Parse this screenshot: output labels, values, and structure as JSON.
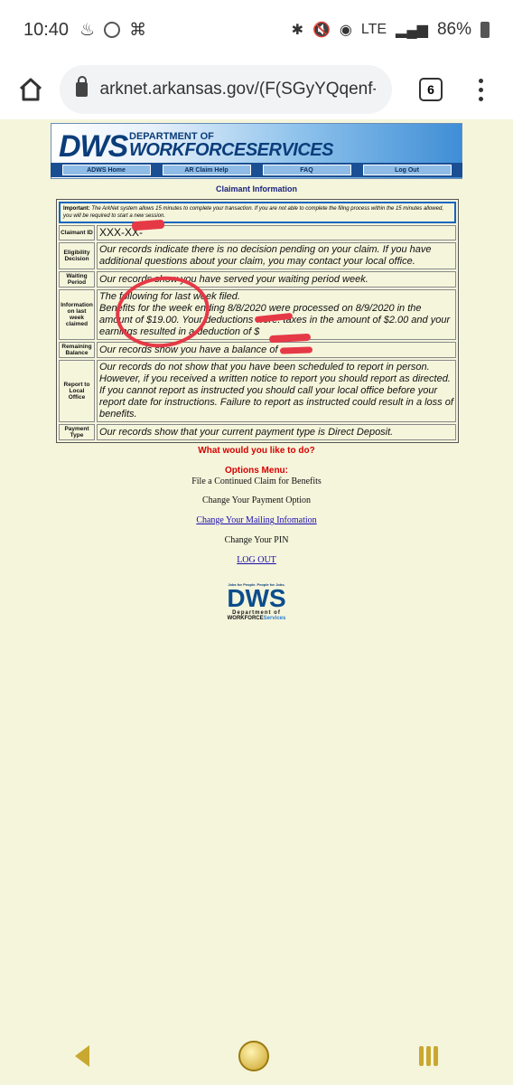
{
  "status_bar": {
    "time": "10:40",
    "network": "LTE",
    "battery": "86%"
  },
  "browser": {
    "url": "arknet.arkansas.gov/(F(SGyYQqenf-IEM",
    "tab_count": "6"
  },
  "header": {
    "logo_dws": "DWS",
    "logo_dept": "DEPARTMENT OF",
    "logo_workforce": "WORKFORCE",
    "logo_services": "SERVICES",
    "nav": [
      "ADWS Home",
      "AR Claim Help",
      "FAQ",
      "Log Out"
    ]
  },
  "claimant": {
    "title": "Claimant Information",
    "important_label": "Important:",
    "important_text": "The ArkNet system allows 15 minutes to complete your transaction. If you are not able to complete the filing process within the 15 minutes allowed, you will be required to start a new session.",
    "rows": [
      {
        "label": "Claimant ID",
        "value": "XXX-XX-"
      },
      {
        "label": "Eligibility Decision",
        "value": "Our records indicate there is no decision pending on your claim. If you have additional questions about your claim, you may contact your local office."
      },
      {
        "label": "Waiting Period",
        "value": "Our records show you have served your waiting period week."
      },
      {
        "label": "Information on last week claimed",
        "value_lines": [
          "The following for last week filed.",
          "Benefits for the week ending 8/8/2020 were processed on 8/9/2020 in the amount of $19.00. Your deductions were: taxes in the amount of $2.00 and your earnings resulted in a deduction of $"
        ]
      },
      {
        "label": "Remaining Balance",
        "value": "Our records show you have a balance of"
      },
      {
        "label": "Report to Local Office",
        "value": "Our records do not show that you have been scheduled to report in person. However, if you received a written notice to report you should report as directed. If you cannot report as instructed you should call your local office before your report date for instructions. Failure to report as instructed could result in a loss of benefits."
      },
      {
        "label": "Payment Type",
        "value": "Our records show that your current payment type is Direct Deposit."
      }
    ]
  },
  "options": {
    "question": "What would you like to do?",
    "menu_title": "Options Menu:",
    "items": [
      "File a Continued Claim for Benefits",
      "Change Your Payment Option",
      "Change Your Mailing Infomation",
      "Change Your PIN",
      "LOG OUT"
    ]
  },
  "footer_logo": {
    "tagline": "Jobs for People. People for Jobs.",
    "dws": "DWS",
    "dept": "Department of",
    "workforce": "WORKFORCE",
    "services": "Services"
  },
  "colors": {
    "page_bg": "#f5f5dc",
    "accent_red": "#d50000",
    "link": "#1a0dab",
    "redaction": "#e53946"
  }
}
